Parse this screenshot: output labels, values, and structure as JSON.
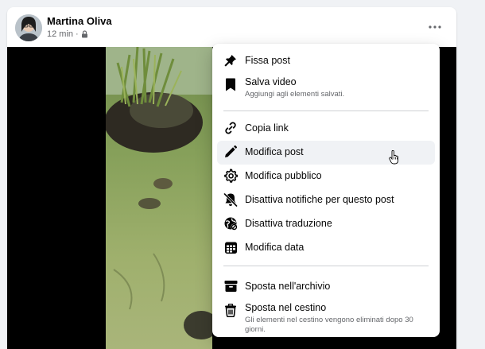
{
  "post": {
    "author": "Martina Oliva",
    "time": "12 min",
    "separator": "·"
  },
  "menu": {
    "items": [
      {
        "label": "Fissa post",
        "icon": "pin-icon"
      },
      {
        "label": "Salva video",
        "sub": "Aggiungi agli elementi salvati.",
        "icon": "bookmark-icon"
      },
      {
        "label": "Copia link",
        "icon": "link-icon"
      },
      {
        "label": "Modifica post",
        "icon": "pencil-icon"
      },
      {
        "label": "Modifica pubblico",
        "icon": "gear-icon"
      },
      {
        "label": "Disattiva notifiche per questo post",
        "icon": "bell-off-icon"
      },
      {
        "label": "Disattiva traduzione",
        "icon": "globe-off-icon"
      },
      {
        "label": "Modifica data",
        "icon": "calendar-icon"
      },
      {
        "label": "Sposta nell'archivio",
        "icon": "archive-icon"
      },
      {
        "label": "Sposta nel cestino",
        "sub": "Gli elementi nel cestino vengono eliminati dopo 30 giorni.",
        "icon": "trash-icon"
      }
    ]
  },
  "colors": {
    "icon": "#050505",
    "secondary_text": "#65676b",
    "hover_bg": "#f0f2f5"
  }
}
